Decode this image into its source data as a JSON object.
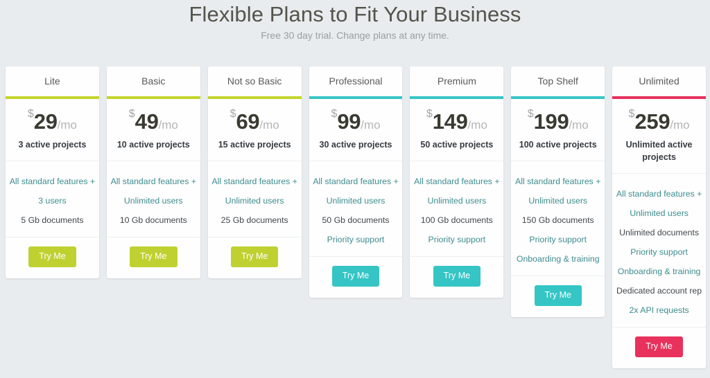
{
  "header": {
    "title": "Flexible Plans to Fit Your Business",
    "subtitle": "Free 30 day trial. Change plans at any time."
  },
  "colors": {
    "page_background": "#e8ecef",
    "card_background": "#fefefe",
    "accent_green": "#c4d52c",
    "accent_teal": "#38c6c6",
    "accent_pink": "#e8315c",
    "button_green": "#bfd130",
    "button_teal": "#35c5c5",
    "button_pink": "#e8315c",
    "title_text": "#54544c",
    "subtitle_text": "#9a9ea1",
    "feature_accent_text": "#3d8c8e",
    "feature_plain_text": "#41464b"
  },
  "currency_symbol": "$",
  "period_label": "/mo",
  "plans": [
    {
      "name": "Lite",
      "price": "29",
      "projects": "3 active projects",
      "accent": "#c4d52c",
      "button_color": "#bfd130",
      "cta": "Try Me",
      "features": [
        {
          "text": "All standard features +",
          "accent": true
        },
        {
          "text": "3 users",
          "accent": true
        },
        {
          "text": "5 Gb documents",
          "accent": false
        }
      ]
    },
    {
      "name": "Basic",
      "price": "49",
      "projects": "10 active projects",
      "accent": "#c4d52c",
      "button_color": "#bfd130",
      "cta": "Try Me",
      "features": [
        {
          "text": "All standard features +",
          "accent": true
        },
        {
          "text": "Unlimited users",
          "accent": true
        },
        {
          "text": "10 Gb documents",
          "accent": false
        }
      ]
    },
    {
      "name": "Not so Basic",
      "price": "69",
      "projects": "15 active projects",
      "accent": "#c4d52c",
      "button_color": "#bfd130",
      "cta": "Try Me",
      "features": [
        {
          "text": "All standard features +",
          "accent": true
        },
        {
          "text": "Unlimited users",
          "accent": true
        },
        {
          "text": "25 Gb documents",
          "accent": false
        }
      ]
    },
    {
      "name": "Professional",
      "price": "99",
      "projects": "30 active projects",
      "accent": "#38c6c6",
      "button_color": "#35c5c5",
      "cta": "Try Me",
      "features": [
        {
          "text": "All standard features +",
          "accent": true
        },
        {
          "text": "Unlimited users",
          "accent": true
        },
        {
          "text": "50 Gb documents",
          "accent": false
        },
        {
          "text": "Priority support",
          "accent": true
        }
      ]
    },
    {
      "name": "Premium",
      "price": "149",
      "projects": "50 active projects",
      "accent": "#38c6c6",
      "button_color": "#35c5c5",
      "cta": "Try Me",
      "features": [
        {
          "text": "All standard features +",
          "accent": true
        },
        {
          "text": "Unlimited users",
          "accent": true
        },
        {
          "text": "100 Gb documents",
          "accent": false
        },
        {
          "text": "Priority support",
          "accent": true
        }
      ]
    },
    {
      "name": "Top Shelf",
      "price": "199",
      "projects": "100 active projects",
      "accent": "#38c6c6",
      "button_color": "#35c5c5",
      "cta": "Try Me",
      "features": [
        {
          "text": "All standard features +",
          "accent": true
        },
        {
          "text": "Unlimited users",
          "accent": true
        },
        {
          "text": "150 Gb documents",
          "accent": false
        },
        {
          "text": "Priority support",
          "accent": true
        },
        {
          "text": "Onboarding & training",
          "accent": true
        }
      ]
    },
    {
      "name": "Unlimited",
      "price": "259",
      "projects": "Unlimited active projects",
      "accent": "#e8315c",
      "button_color": "#e8315c",
      "cta": "Try Me",
      "features": [
        {
          "text": "All standard features +",
          "accent": true
        },
        {
          "text": "Unlimited users",
          "accent": true
        },
        {
          "text": "Unlimited documents",
          "accent": false
        },
        {
          "text": "Priority support",
          "accent": true
        },
        {
          "text": "Onboarding & training",
          "accent": true
        },
        {
          "text": "Dedicated account rep",
          "accent": false
        },
        {
          "text": "2x API requests",
          "accent": true
        }
      ]
    }
  ]
}
